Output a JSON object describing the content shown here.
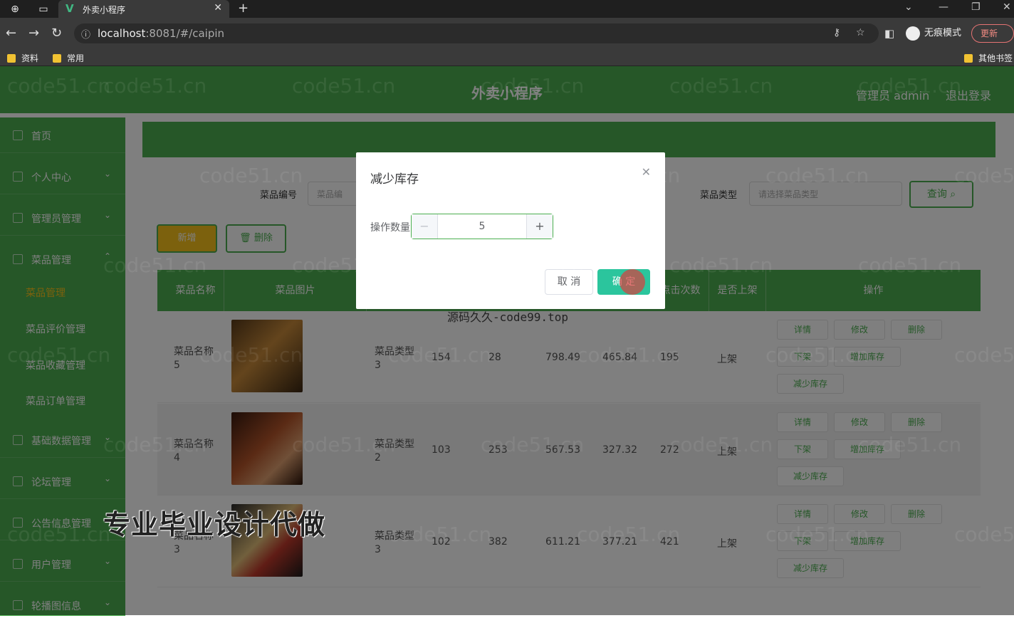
{
  "browser": {
    "tab_title": "外卖小程序",
    "url_host": "localhost",
    "url_rest": ":8081/#/caipin",
    "incognito_label": "无痕模式",
    "update_label": "更新",
    "bookmarks": [
      "资料",
      "常用"
    ],
    "other_bookmarks": "其他书签"
  },
  "header": {
    "title": "外卖小程序",
    "user": "管理员 admin",
    "logout": "退出登录"
  },
  "sidebar": {
    "items": [
      {
        "label": "首页",
        "chevron": ""
      },
      {
        "label": "个人中心",
        "chevron": "⌄"
      },
      {
        "label": "管理员管理",
        "chevron": "⌄"
      },
      {
        "label": "菜品管理",
        "chevron": "⌃"
      }
    ],
    "sub_items": [
      "菜品管理",
      "菜品评价管理",
      "菜品收藏管理",
      "菜品订单管理"
    ],
    "items2": [
      {
        "label": "基础数据管理",
        "chevron": "⌄"
      },
      {
        "label": "论坛管理",
        "chevron": "⌄"
      },
      {
        "label": "公告信息管理",
        "chevron": "⌄"
      },
      {
        "label": "用户管理",
        "chevron": "⌄"
      },
      {
        "label": "轮播图信息",
        "chevron": "⌄"
      }
    ]
  },
  "search": {
    "code_label": "菜品编号",
    "code_placeholder": "菜品编",
    "type_label": "菜品类型",
    "type_placeholder": "请选择菜品类型",
    "query_label": "查询"
  },
  "toolbar": {
    "add_label": "新增",
    "delete_label": "删除"
  },
  "table": {
    "headers": [
      "菜品名称",
      "菜品图片",
      "点击次数",
      "是否上架",
      "操作"
    ],
    "rows": [
      {
        "name": "菜品名称",
        "name_num": "5",
        "type": "菜品类型",
        "type_num": "3",
        "c1": "154",
        "c2": "28",
        "c3": "798.49",
        "c4": "465.84",
        "clicks": "195",
        "status": "上架"
      },
      {
        "name": "菜品名称",
        "name_num": "4",
        "type": "菜品类型",
        "type_num": "2",
        "c1": "103",
        "c2": "253",
        "c3": "567.53",
        "c4": "327.32",
        "clicks": "272",
        "status": "上架"
      },
      {
        "name": "菜品名称",
        "name_num": "3",
        "type": "菜品类型",
        "type_num": "3",
        "c1": "102",
        "c2": "382",
        "c3": "611.21",
        "c4": "377.21",
        "clicks": "421",
        "status": "上架"
      }
    ],
    "actions": {
      "detail": "详情",
      "edit": "修改",
      "delete": "删除",
      "off": "下架",
      "add_stock": "增加库存",
      "reduce_stock": "减少库存"
    }
  },
  "dialog": {
    "title": "减少库存",
    "field_label": "操作数量",
    "quantity": "5",
    "cancel_label": "取 消",
    "confirm_label": "确 定"
  },
  "overlay_text": {
    "promo": "专业毕业设计代做",
    "site": "源码久久-code99.top",
    "watermark": "code51.cn"
  }
}
